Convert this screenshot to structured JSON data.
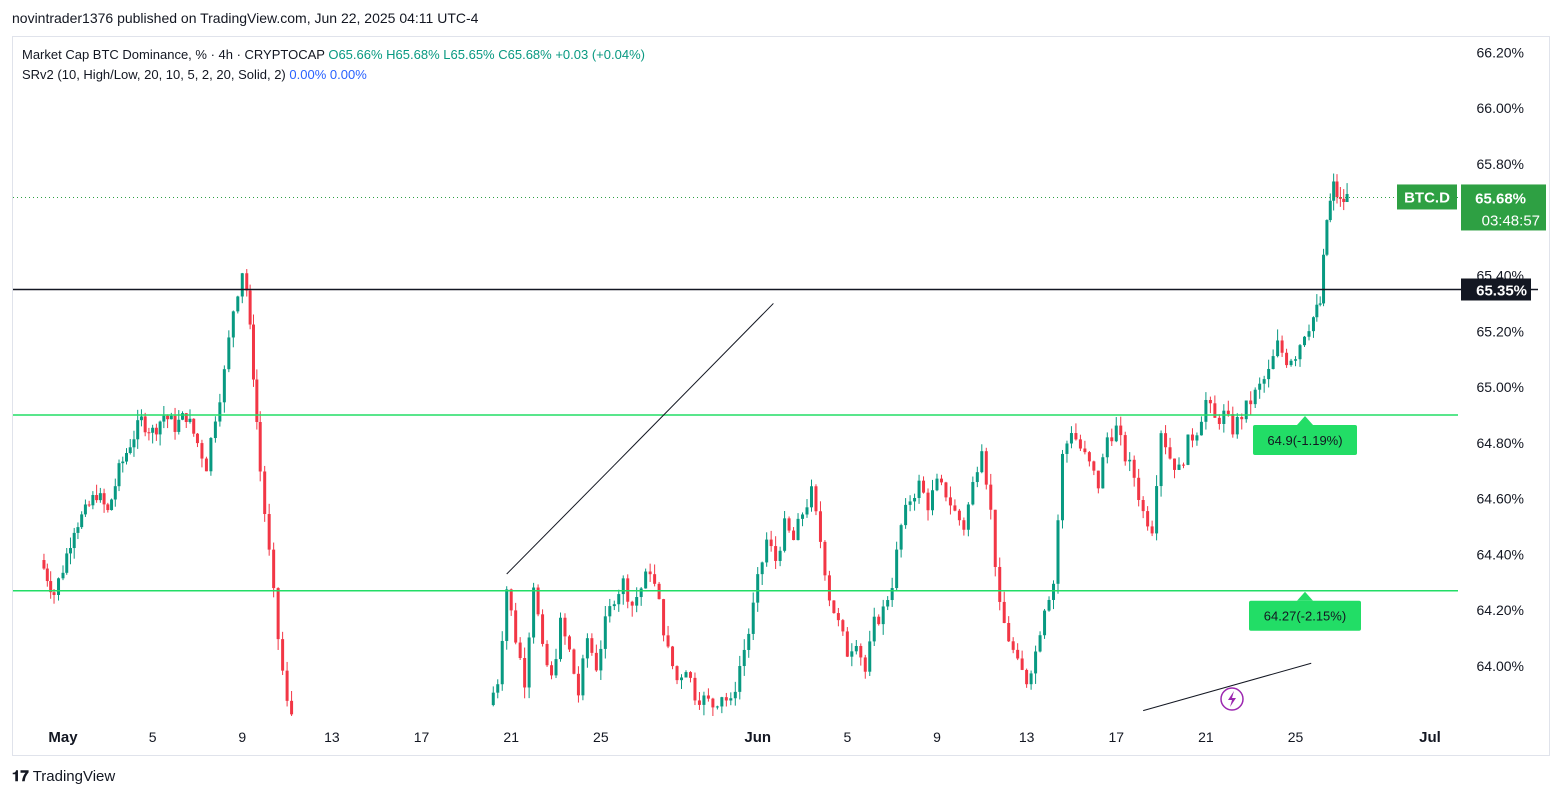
{
  "header": {
    "publisher_line": "novintrader1376 published on TradingView.com, Jun 22, 2025 04:11 UTC-4"
  },
  "legend": {
    "symbol_line": "Market Cap BTC Dominance, % · 4h · CRYPTOCAP",
    "open": "O65.66%",
    "high": "H65.68%",
    "low": "L65.65%",
    "close": "C65.68%",
    "change": "+0.03 (+0.04%)",
    "indicator": "SRv2 (10, High/Low, 20, 10, 5, 2, 20, Solid, 2)",
    "ind_val1": "0.00%",
    "ind_val2": "0.00%"
  },
  "tags": {
    "symbol": "BTC.D",
    "price": "65.68%",
    "countdown": "03:48:57",
    "hline_price": "65.35%"
  },
  "footer": {
    "brand": "TradingView"
  },
  "colors": {
    "up": "#089981",
    "down": "#f23645",
    "support": "#22dd66",
    "tag_green": "#2ea043"
  },
  "chart_data": {
    "type": "candlestick",
    "timeframe": "4h",
    "ylim": [
      63.82,
      66.28
    ],
    "y_ticks": [
      "66.20%",
      "66.00%",
      "65.80%",
      "65.40%",
      "65.20%",
      "65.00%",
      "64.80%",
      "64.60%",
      "64.40%",
      "64.20%",
      "64.00%"
    ],
    "y_tick_values": [
      66.2,
      66.0,
      65.8,
      65.4,
      65.2,
      65.0,
      64.8,
      64.6,
      64.4,
      64.2,
      64.0
    ],
    "x_ticks": [
      {
        "label": "May",
        "day": 1
      },
      {
        "label": "5",
        "day": 5
      },
      {
        "label": "9",
        "day": 9
      },
      {
        "label": "13",
        "day": 13
      },
      {
        "label": "17",
        "day": 17
      },
      {
        "label": "21",
        "day": 21
      },
      {
        "label": "25",
        "day": 25
      },
      {
        "label": "Jun",
        "day": 32
      },
      {
        "label": "5",
        "day": 36
      },
      {
        "label": "9",
        "day": 40
      },
      {
        "label": "13",
        "day": 44
      },
      {
        "label": "17",
        "day": 48
      },
      {
        "label": "21",
        "day": 52
      },
      {
        "label": "25",
        "day": 56
      },
      {
        "label": "Jul",
        "day": 62
      }
    ],
    "horizontal_line": 65.35,
    "support_levels": [
      {
        "price": 64.9,
        "label": "64.9(-1.19%)"
      },
      {
        "price": 64.27,
        "label": "64.27(-2.15%)"
      }
    ],
    "trendlines": [
      {
        "from": [
          20.8,
          64.33
        ],
        "to": [
          25.6,
          64.72
        ]
      },
      {
        "from": [
          25.6,
          64.72
        ],
        "to": [
          32.7,
          65.3
        ]
      },
      {
        "from": [
          56.7,
          64.01
        ],
        "to": [
          49.2,
          63.84
        ]
      }
    ],
    "close_path": [
      [
        0.0,
        64.38
      ],
      [
        0.6,
        64.26
      ],
      [
        1.0,
        64.35
      ],
      [
        1.5,
        64.5
      ],
      [
        2.0,
        64.55
      ],
      [
        2.5,
        64.62
      ],
      [
        3.0,
        64.55
      ],
      [
        3.5,
        64.7
      ],
      [
        4.0,
        64.8
      ],
      [
        4.5,
        64.88
      ],
      [
        5.0,
        64.84
      ],
      [
        5.5,
        64.9
      ],
      [
        6.0,
        64.86
      ],
      [
        6.5,
        64.9
      ],
      [
        7.0,
        64.8
      ],
      [
        7.4,
        64.72
      ],
      [
        7.8,
        64.9
      ],
      [
        8.2,
        65.05
      ],
      [
        8.6,
        65.28
      ],
      [
        9.0,
        65.42
      ],
      [
        9.2,
        65.35
      ],
      [
        9.5,
        65.05
      ],
      [
        9.8,
        64.7
      ],
      [
        10.2,
        64.4
      ],
      [
        10.6,
        64.1
      ],
      [
        11.0,
        63.86
      ],
      [
        11.2,
        63.83
      ]
    ],
    "close_path_2": [
      [
        20.0,
        63.86
      ],
      [
        20.4,
        63.95
      ],
      [
        20.8,
        64.28
      ],
      [
        21.2,
        64.1
      ],
      [
        21.6,
        63.95
      ],
      [
        22.0,
        64.3
      ],
      [
        22.4,
        64.05
      ],
      [
        22.8,
        63.95
      ],
      [
        23.2,
        64.15
      ],
      [
        23.6,
        64.05
      ],
      [
        24.0,
        63.9
      ],
      [
        24.4,
        64.1
      ],
      [
        24.8,
        64.0
      ],
      [
        25.2,
        64.15
      ],
      [
        25.6,
        64.25
      ],
      [
        26.0,
        64.3
      ],
      [
        26.4,
        64.22
      ],
      [
        26.8,
        64.28
      ],
      [
        27.2,
        64.35
      ],
      [
        27.6,
        64.22
      ],
      [
        28.0,
        64.05
      ],
      [
        28.4,
        63.95
      ],
      [
        28.8,
        64.0
      ],
      [
        29.2,
        63.9
      ],
      [
        29.6,
        63.88
      ],
      [
        30.0,
        63.86
      ],
      [
        30.4,
        63.9
      ],
      [
        30.8,
        63.86
      ],
      [
        31.2,
        64.0
      ],
      [
        31.6,
        64.12
      ],
      [
        32.0,
        64.3
      ],
      [
        32.4,
        64.45
      ],
      [
        32.8,
        64.38
      ],
      [
        33.2,
        64.5
      ],
      [
        33.6,
        64.45
      ],
      [
        34.0,
        64.55
      ],
      [
        34.4,
        64.62
      ],
      [
        34.8,
        64.45
      ],
      [
        35.2,
        64.25
      ],
      [
        35.6,
        64.15
      ],
      [
        36.0,
        64.05
      ],
      [
        36.4,
        64.1
      ],
      [
        36.8,
        63.98
      ],
      [
        37.2,
        64.15
      ],
      [
        37.6,
        64.2
      ],
      [
        38.0,
        64.3
      ],
      [
        38.4,
        64.5
      ],
      [
        38.8,
        64.6
      ],
      [
        39.2,
        64.65
      ],
      [
        39.6,
        64.58
      ],
      [
        40.0,
        64.65
      ],
      [
        40.4,
        64.62
      ],
      [
        40.8,
        64.55
      ],
      [
        41.2,
        64.5
      ],
      [
        41.6,
        64.65
      ],
      [
        42.0,
        64.8
      ],
      [
        42.4,
        64.55
      ],
      [
        42.8,
        64.2
      ],
      [
        43.2,
        64.1
      ],
      [
        43.6,
        64.0
      ],
      [
        44.0,
        63.95
      ],
      [
        44.4,
        64.05
      ],
      [
        44.8,
        64.22
      ],
      [
        45.2,
        64.3
      ],
      [
        45.6,
        64.75
      ],
      [
        46.0,
        64.85
      ],
      [
        46.4,
        64.78
      ],
      [
        46.8,
        64.72
      ],
      [
        47.2,
        64.65
      ],
      [
        47.6,
        64.82
      ],
      [
        48.0,
        64.85
      ],
      [
        48.4,
        64.75
      ],
      [
        48.8,
        64.68
      ],
      [
        49.2,
        64.55
      ],
      [
        49.6,
        64.5
      ],
      [
        50.0,
        64.85
      ],
      [
        50.4,
        64.75
      ],
      [
        50.8,
        64.7
      ],
      [
        51.2,
        64.8
      ],
      [
        51.6,
        64.85
      ],
      [
        52.0,
        64.95
      ],
      [
        52.4,
        64.88
      ],
      [
        52.8,
        64.9
      ],
      [
        53.2,
        64.85
      ],
      [
        53.6,
        64.9
      ],
      [
        54.0,
        64.95
      ],
      [
        54.4,
        65.0
      ],
      [
        54.8,
        65.05
      ],
      [
        55.2,
        65.15
      ],
      [
        55.6,
        65.1
      ],
      [
        56.0,
        65.12
      ],
      [
        56.4,
        65.2
      ],
      [
        56.8,
        65.25
      ],
      [
        57.1,
        65.3
      ],
      [
        57.4,
        65.6
      ],
      [
        57.7,
        65.72
      ],
      [
        58.0,
        65.66
      ],
      [
        58.3,
        65.68
      ]
    ],
    "last_price": 65.68
  }
}
